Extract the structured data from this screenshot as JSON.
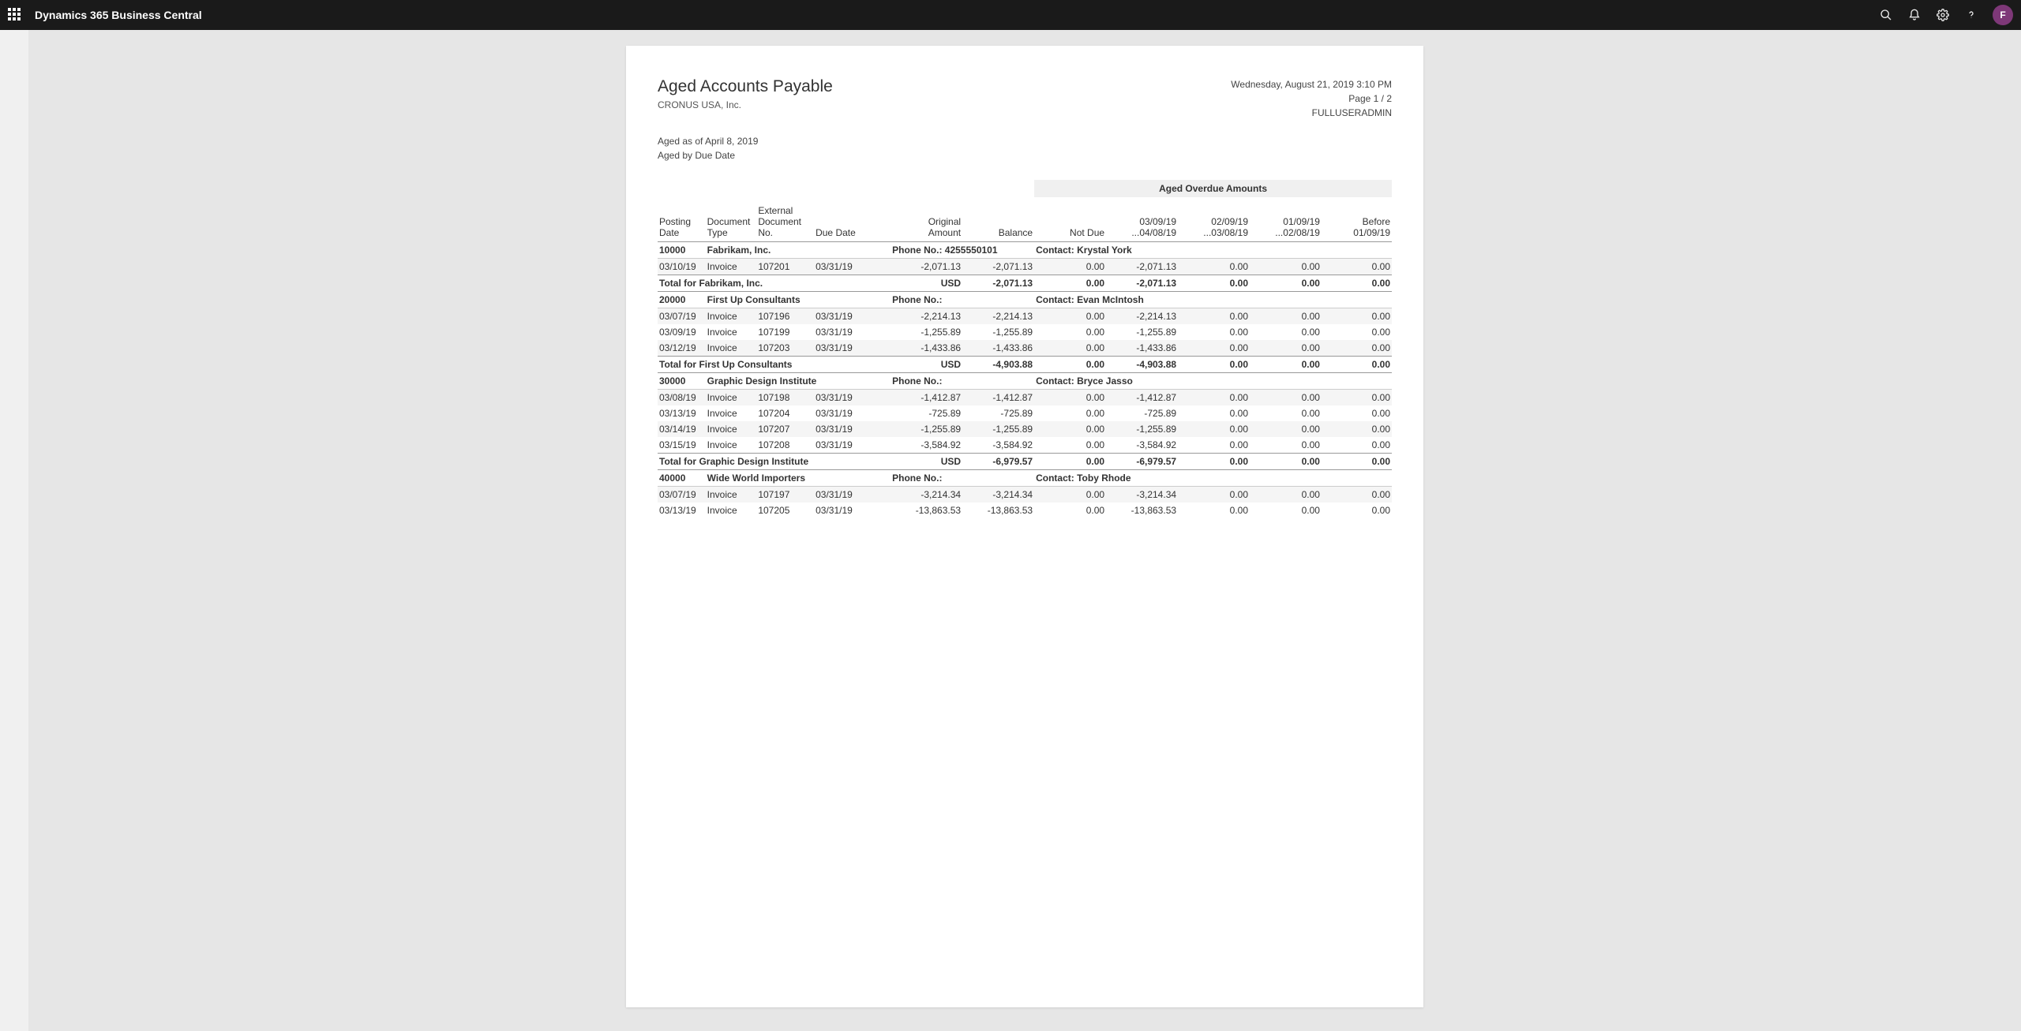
{
  "header": {
    "app_title": "Dynamics 365 Business Central",
    "avatar_initial": "F"
  },
  "report": {
    "title": "Aged Accounts Payable",
    "company": "CRONUS USA, Inc.",
    "timestamp": "Wednesday, August 21, 2019 3:10 PM",
    "page_info": "Page 1 / 2",
    "username": "FULLUSERADMIN",
    "aged_as_of": "Aged as of April 8, 2019",
    "aged_by": "Aged by Due Date",
    "aged_group_label": "Aged Overdue Amounts",
    "columns": {
      "posting_date_l1": "Posting",
      "posting_date_l2": "Date",
      "document_type_l1": "Document",
      "document_type_l2": "Type",
      "ext_doc_l1": "External",
      "ext_doc_l2": "Document No.",
      "due_date": "Due Date",
      "orig_amt_l1": "Original",
      "orig_amt_l2": "Amount",
      "balance": "Balance",
      "not_due": "Not Due",
      "period1_l1": "03/09/19",
      "period1_l2": "...04/08/19",
      "period2_l1": "02/09/19",
      "period2_l2": "...03/08/19",
      "period3_l1": "01/09/19",
      "period3_l2": "...02/08/19",
      "before_l1": "Before",
      "before_l2": "01/09/19"
    },
    "phone_label": "Phone No.:",
    "contact_label": "Contact:",
    "total_for_label": "Total for",
    "currency": "USD",
    "vendors": [
      {
        "no": "10000",
        "name": "Fabrikam, Inc.",
        "phone": "4255550101",
        "contact": "Krystal York",
        "lines": [
          {
            "posting_date": "03/10/19",
            "doc_type": "Invoice",
            "ext_doc": "107201",
            "due_date": "03/31/19",
            "orig": "-2,071.13",
            "bal": "-2,071.13",
            "not_due": "0.00",
            "p1": "-2,071.13",
            "p2": "0.00",
            "p3": "0.00",
            "before": "0.00"
          }
        ],
        "total": {
          "bal": "-2,071.13",
          "not_due": "0.00",
          "p1": "-2,071.13",
          "p2": "0.00",
          "p3": "0.00",
          "before": "0.00"
        }
      },
      {
        "no": "20000",
        "name": "First Up Consultants",
        "phone": "",
        "contact": "Evan McIntosh",
        "lines": [
          {
            "posting_date": "03/07/19",
            "doc_type": "Invoice",
            "ext_doc": "107196",
            "due_date": "03/31/19",
            "orig": "-2,214.13",
            "bal": "-2,214.13",
            "not_due": "0.00",
            "p1": "-2,214.13",
            "p2": "0.00",
            "p3": "0.00",
            "before": "0.00"
          },
          {
            "posting_date": "03/09/19",
            "doc_type": "Invoice",
            "ext_doc": "107199",
            "due_date": "03/31/19",
            "orig": "-1,255.89",
            "bal": "-1,255.89",
            "not_due": "0.00",
            "p1": "-1,255.89",
            "p2": "0.00",
            "p3": "0.00",
            "before": "0.00"
          },
          {
            "posting_date": "03/12/19",
            "doc_type": "Invoice",
            "ext_doc": "107203",
            "due_date": "03/31/19",
            "orig": "-1,433.86",
            "bal": "-1,433.86",
            "not_due": "0.00",
            "p1": "-1,433.86",
            "p2": "0.00",
            "p3": "0.00",
            "before": "0.00"
          }
        ],
        "total": {
          "bal": "-4,903.88",
          "not_due": "0.00",
          "p1": "-4,903.88",
          "p2": "0.00",
          "p3": "0.00",
          "before": "0.00"
        }
      },
      {
        "no": "30000",
        "name": "Graphic Design Institute",
        "phone": "",
        "contact": "Bryce Jasso",
        "lines": [
          {
            "posting_date": "03/08/19",
            "doc_type": "Invoice",
            "ext_doc": "107198",
            "due_date": "03/31/19",
            "orig": "-1,412.87",
            "bal": "-1,412.87",
            "not_due": "0.00",
            "p1": "-1,412.87",
            "p2": "0.00",
            "p3": "0.00",
            "before": "0.00"
          },
          {
            "posting_date": "03/13/19",
            "doc_type": "Invoice",
            "ext_doc": "107204",
            "due_date": "03/31/19",
            "orig": "-725.89",
            "bal": "-725.89",
            "not_due": "0.00",
            "p1": "-725.89",
            "p2": "0.00",
            "p3": "0.00",
            "before": "0.00"
          },
          {
            "posting_date": "03/14/19",
            "doc_type": "Invoice",
            "ext_doc": "107207",
            "due_date": "03/31/19",
            "orig": "-1,255.89",
            "bal": "-1,255.89",
            "not_due": "0.00",
            "p1": "-1,255.89",
            "p2": "0.00",
            "p3": "0.00",
            "before": "0.00"
          },
          {
            "posting_date": "03/15/19",
            "doc_type": "Invoice",
            "ext_doc": "107208",
            "due_date": "03/31/19",
            "orig": "-3,584.92",
            "bal": "-3,584.92",
            "not_due": "0.00",
            "p1": "-3,584.92",
            "p2": "0.00",
            "p3": "0.00",
            "before": "0.00"
          }
        ],
        "total": {
          "bal": "-6,979.57",
          "not_due": "0.00",
          "p1": "-6,979.57",
          "p2": "0.00",
          "p3": "0.00",
          "before": "0.00"
        }
      },
      {
        "no": "40000",
        "name": "Wide World Importers",
        "phone": "",
        "contact": "Toby Rhode",
        "lines": [
          {
            "posting_date": "03/07/19",
            "doc_type": "Invoice",
            "ext_doc": "107197",
            "due_date": "03/31/19",
            "orig": "-3,214.34",
            "bal": "-3,214.34",
            "not_due": "0.00",
            "p1": "-3,214.34",
            "p2": "0.00",
            "p3": "0.00",
            "before": "0.00"
          },
          {
            "posting_date": "03/13/19",
            "doc_type": "Invoice",
            "ext_doc": "107205",
            "due_date": "03/31/19",
            "orig": "-13,863.53",
            "bal": "-13,863.53",
            "not_due": "0.00",
            "p1": "-13,863.53",
            "p2": "0.00",
            "p3": "0.00",
            "before": "0.00"
          }
        ],
        "total": null
      }
    ]
  }
}
